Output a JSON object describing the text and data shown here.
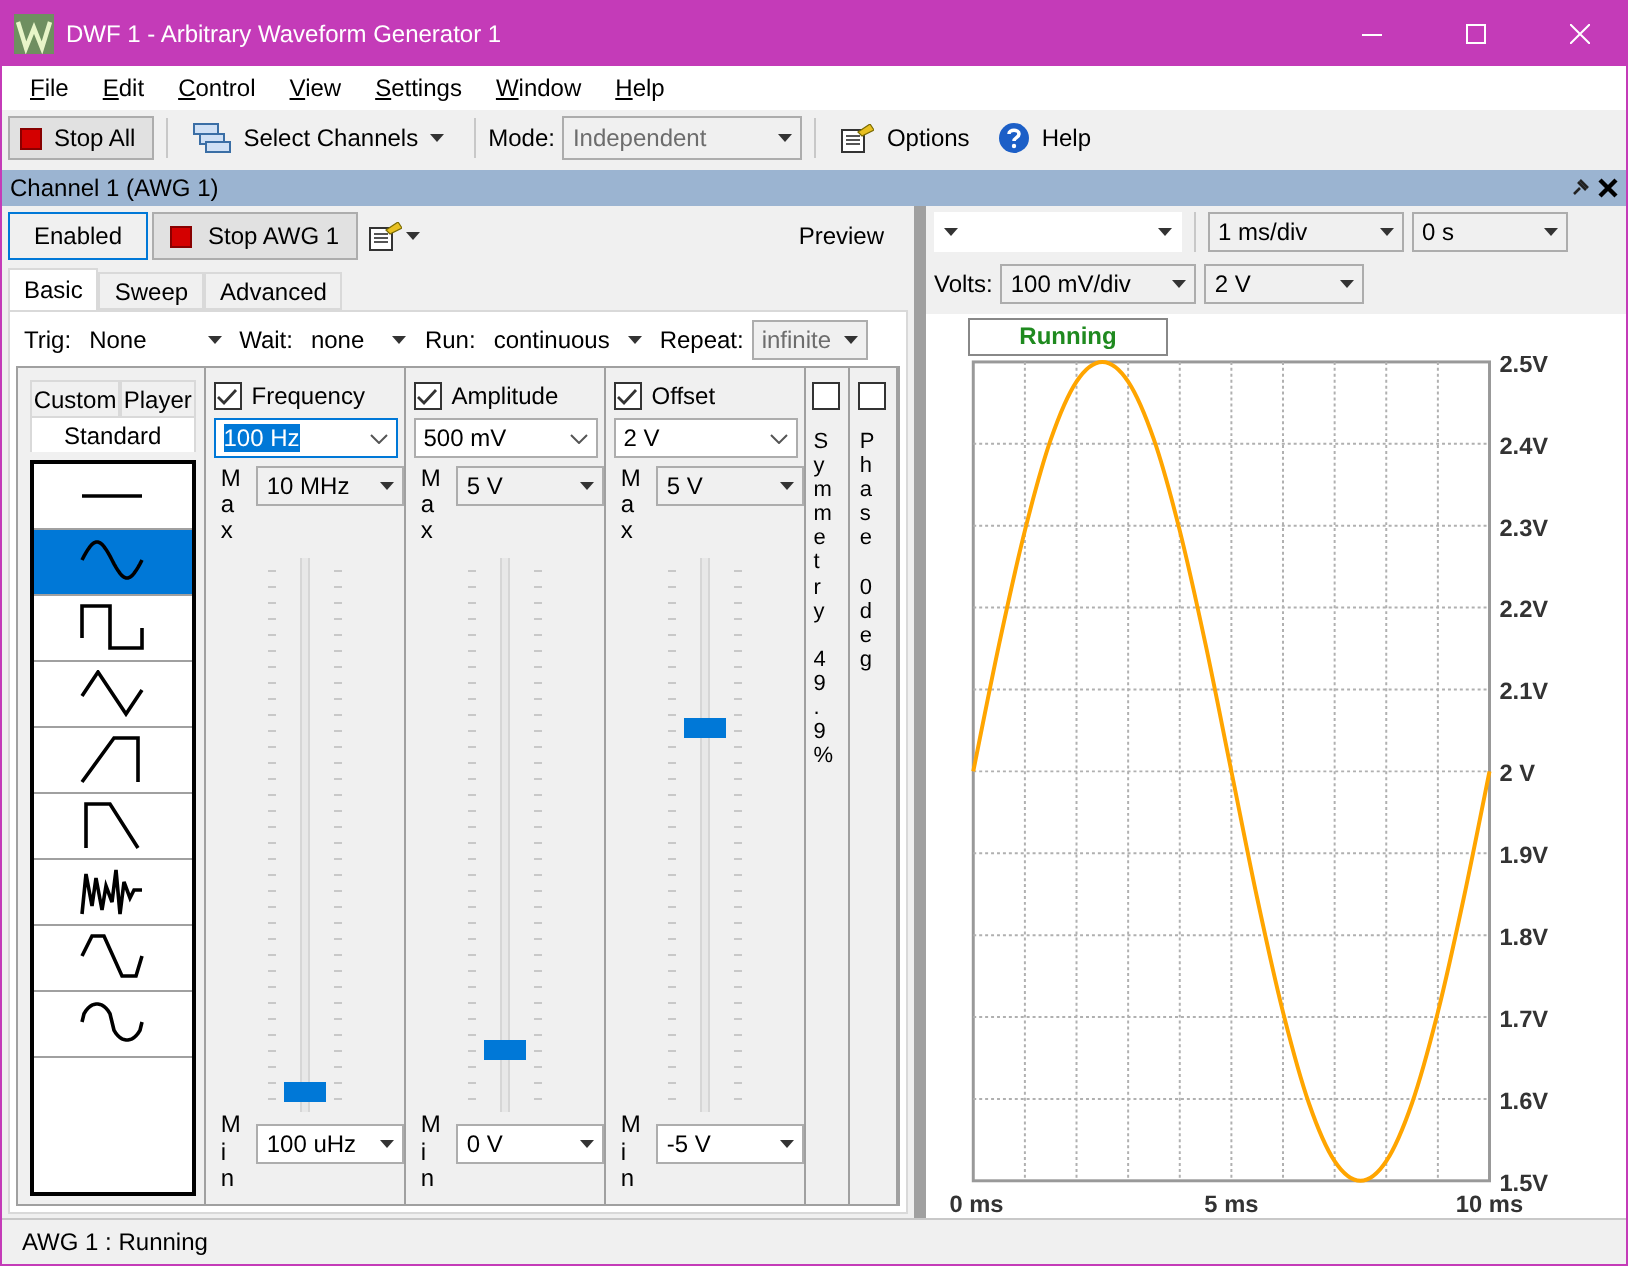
{
  "window": {
    "title": "DWF 1 - Arbitrary Waveform Generator 1"
  },
  "menu": [
    "File",
    "Edit",
    "Control",
    "View",
    "Settings",
    "Window",
    "Help"
  ],
  "toolbar": {
    "stop_all": "Stop All",
    "select_channels": "Select Channels",
    "mode_label": "Mode:",
    "mode": {
      "value": "Independent",
      "disabled": true
    },
    "options": "Options",
    "help": "Help"
  },
  "channel": {
    "title": "Channel 1 (AWG 1)",
    "enabled": "Enabled",
    "stop": "Stop AWG 1",
    "preview": "Preview",
    "tabs": [
      {
        "label": "Basic",
        "selected": true
      },
      {
        "label": "Sweep",
        "selected": false
      },
      {
        "label": "Advanced",
        "selected": false
      }
    ],
    "settings": [
      {
        "label": "Trig:",
        "value": "None",
        "disabled": false
      },
      {
        "label": "Wait:",
        "value": "none",
        "disabled": false
      },
      {
        "label": "Run:",
        "value": "continuous",
        "disabled": false
      },
      {
        "label": "Repeat:",
        "value": "infinite",
        "disabled": true
      }
    ],
    "wave_tabs": [
      {
        "label": "Custom",
        "selected": false
      },
      {
        "label": "Player",
        "selected": false
      },
      {
        "label": "Standard",
        "selected": true
      }
    ],
    "waveforms": [
      {
        "kind": "dc",
        "selected": false
      },
      {
        "kind": "sine",
        "selected": true
      },
      {
        "kind": "square",
        "selected": false
      },
      {
        "kind": "triangle",
        "selected": false
      },
      {
        "kind": "ramp_up",
        "selected": false
      },
      {
        "kind": "ramp_down",
        "selected": false
      },
      {
        "kind": "noise",
        "selected": false
      },
      {
        "kind": "trapezium",
        "selected": false
      },
      {
        "kind": "sine_power",
        "selected": false
      }
    ],
    "params": [
      {
        "label": "Frequency",
        "checked": true,
        "value": "100 Hz",
        "focused": true,
        "max_label": "Max",
        "max": "10 MHz",
        "min_label": "Min",
        "min": "100 uHz",
        "level": 0.02
      },
      {
        "label": "Amplitude",
        "checked": true,
        "value": "500 mV",
        "focused": false,
        "max_label": "Max",
        "max": "5 V",
        "min_label": "Min",
        "min": "0 V",
        "level": 0.1
      },
      {
        "label": "Offset",
        "checked": true,
        "value": "2 V",
        "focused": false,
        "max_label": "Max",
        "max": "5 V",
        "min_label": "Min",
        "min": "-5 V",
        "level": 0.7
      }
    ],
    "extras": [
      {
        "label": "Symmetry 49.9%",
        "checked": false
      },
      {
        "label": "Phase 0deg",
        "checked": false
      }
    ]
  },
  "scope": {
    "time_base": "1 ms/div",
    "time_offset": "0 s",
    "volts_label": "Volts:",
    "volts": "100 mV/div",
    "volts_offset": "2 V",
    "status": "Running",
    "chart_data": {
      "type": "line",
      "x": [
        0,
        0.5,
        1,
        1.5,
        2,
        2.5,
        3,
        3.5,
        4,
        4.5,
        5,
        5.5,
        6,
        6.5,
        7,
        7.5,
        8,
        8.5,
        9,
        9.5,
        10
      ],
      "grid": true,
      "series": [
        {
          "color": "#ffa500",
          "values": [
            2,
            2.155,
            2.294,
            2.405,
            2.476,
            2.5,
            2.476,
            2.405,
            2.294,
            2.155,
            2,
            1.845,
            1.706,
            1.595,
            1.524,
            1.5,
            1.524,
            1.595,
            1.706,
            1.845,
            2
          ]
        }
      ],
      "xlim": [
        0,
        10
      ],
      "ylim": [
        1.5,
        2.5
      ],
      "xticks": [
        {
          "value": 0,
          "label": "0 ms"
        },
        {
          "value": 5,
          "label": "5 ms"
        },
        {
          "value": 10,
          "label": "10 ms"
        }
      ],
      "yticks": [
        {
          "value": 2.5,
          "label": "2.5V"
        },
        {
          "value": 2.4,
          "label": "2.4V"
        },
        {
          "value": 2.3,
          "label": "2.3V"
        },
        {
          "value": 2.2,
          "label": "2.2V"
        },
        {
          "value": 2.1,
          "label": "2.1V"
        },
        {
          "value": 2,
          "label": "2 V"
        },
        {
          "value": 1.9,
          "label": "1.9V"
        },
        {
          "value": 1.8,
          "label": "1.8V"
        },
        {
          "value": 1.7,
          "label": "1.7V"
        },
        {
          "value": 1.6,
          "label": "1.6V"
        },
        {
          "value": 1.5,
          "label": "1.5V"
        }
      ]
    }
  },
  "status_bar": "AWG 1 : Running"
}
